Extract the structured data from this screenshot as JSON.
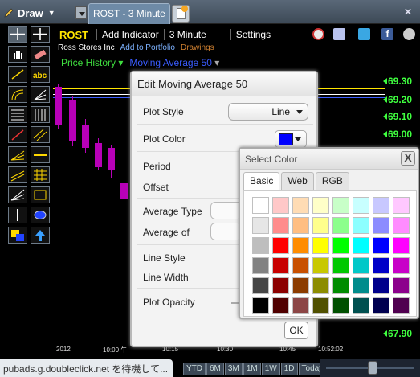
{
  "topbar": {
    "draw_label": "Draw",
    "tabs": [
      {
        "label": "ROST - 3 Minute"
      }
    ]
  },
  "header": {
    "symbol": "ROST",
    "add_indicator": "Add Indicator",
    "interval": "3 Minute",
    "settings": "Settings",
    "company": "Ross Stores Inc",
    "add_portfolio": "Add to Portfolio",
    "drawings": "Drawings",
    "price_history": "Price History",
    "study": "Moving Average 50"
  },
  "toolbar": {
    "icons": [
      "crosshair-icon",
      "crosshair-plus-icon",
      "hand-icon",
      "eraser-icon",
      "line-icon",
      "text-abc-icon",
      "fibonacci-arc-icon",
      "fibonacci-fan-icon",
      "fibonacci-lines-icon",
      "vertical-lines-icon",
      "diagonal-line-icon",
      "parallel-lines-icon",
      "fan-lines-icon",
      "horizontal-line-icon",
      "channel-icon",
      "grid-lines-icon",
      "speed-lines-icon",
      "box-icon",
      "vertical-line-icon",
      "ellipse-icon",
      "layer-icon",
      "arrow-up-icon"
    ]
  },
  "chart": {
    "y_labels": [
      "69.30",
      "69.20",
      "69.10",
      "69.00",
      "67.90"
    ],
    "x_labels": [
      "2012",
      "10:00 午",
      "10:15",
      "10:30",
      "10:45",
      "10:52:02"
    ],
    "candle_color": "#b800b8",
    "ma_line_color": "#ffe600"
  },
  "dialog": {
    "title": "Edit Moving Average 50",
    "plot_style_label": "Plot Style",
    "plot_style_value": "Line",
    "plot_color_label": "Plot Color",
    "plot_color_value": "#0000ff",
    "period_label": "Period",
    "offset_label": "Offset",
    "average_type_label": "Average Type",
    "average_of_label": "Average of",
    "line_style_label": "Line Style",
    "line_width_label": "Line Width",
    "plot_opacity_label": "Plot Opacity",
    "ok_label": "OK"
  },
  "select_color": {
    "title": "Select Color",
    "close": "X",
    "tabs": [
      "Basic",
      "Web",
      "RGB"
    ],
    "active_tab": "Basic",
    "swatches": [
      [
        "#ffffff",
        "#ffc8c8",
        "#ffdcb4",
        "#ffffc8",
        "#c8ffc8",
        "#c8ffff",
        "#c8c8ff",
        "#ffc8ff"
      ],
      [
        "#e6e6e6",
        "#ff8c8c",
        "#ffbe82",
        "#ffff8c",
        "#8cff8c",
        "#8cffff",
        "#8c8cff",
        "#ff8cff"
      ],
      [
        "#bebebe",
        "#ff0000",
        "#ff8c00",
        "#ffff00",
        "#00ff00",
        "#00ffff",
        "#0000ff",
        "#ff00ff"
      ],
      [
        "#828282",
        "#c80000",
        "#c85000",
        "#c8c800",
        "#00c800",
        "#00c8c8",
        "#0000c8",
        "#c800c8"
      ],
      [
        "#464646",
        "#8c0000",
        "#8c3c00",
        "#8c8c00",
        "#008c00",
        "#008c8c",
        "#00008c",
        "#8c008c"
      ],
      [
        "#000000",
        "#500000",
        "#8c4646",
        "#505000",
        "#005000",
        "#005050",
        "#000050",
        "#500050"
      ]
    ]
  },
  "range_buttons": [
    "YTD",
    "6M",
    "3M",
    "1M",
    "1W",
    "1D",
    "Today"
  ],
  "status_text": "pubads.g.doubleclick.net を待機して..."
}
